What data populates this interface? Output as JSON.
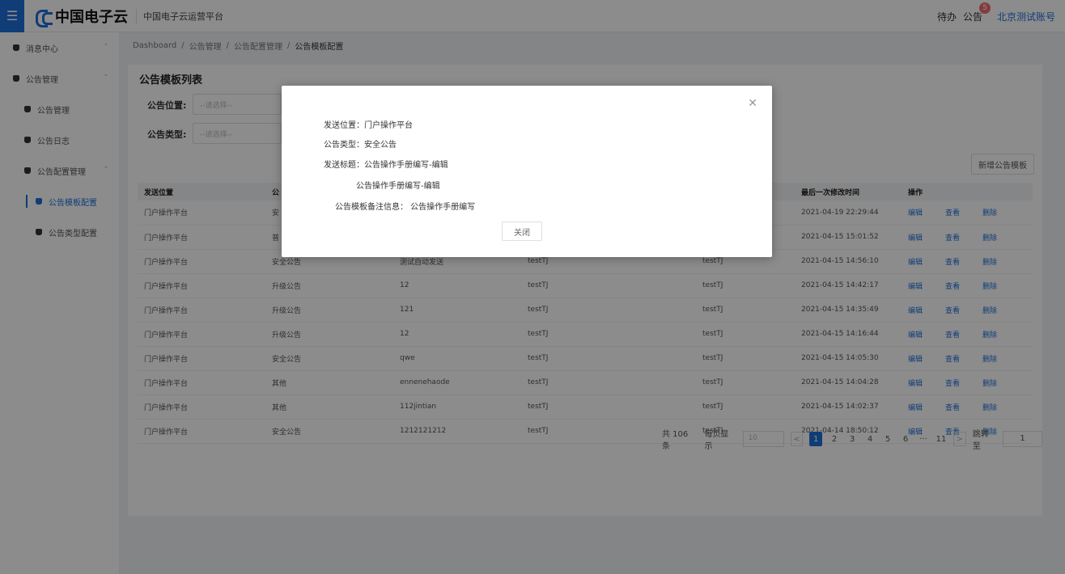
{
  "header": {
    "menu_icon": "hamburger-icon",
    "logo_text": "中国电子云",
    "platform": "中国电子云运营平台",
    "todo": "待办",
    "notice": "公告",
    "notice_badge": "5",
    "account": "北京测试账号"
  },
  "sidebar": {
    "items": [
      {
        "label": "消息中心",
        "expand": "˅"
      },
      {
        "label": "公告管理",
        "expand": "˄"
      },
      {
        "label": "公告管理"
      },
      {
        "label": "公告日志"
      },
      {
        "label": "公告配置管理",
        "expand": "˄"
      },
      {
        "label": "公告模板配置"
      },
      {
        "label": "公告类型配置"
      }
    ]
  },
  "breadcrumb": [
    "Dashboard",
    "/",
    "公告管理",
    "/",
    "公告配置管理",
    "/",
    "公告模板配置"
  ],
  "card": {
    "title": "公告模板列表",
    "filter_position_label": "公告位置:",
    "filter_position_placeholder": "--请选择--",
    "filter_type_label": "公告类型:",
    "filter_type_placeholder": "--请选择--",
    "add_button": "新增公告模板"
  },
  "table": {
    "headers": [
      "发送位置",
      "公",
      "",
      "",
      "",
      "最后一次修改时间",
      "操作",
      "",
      ""
    ],
    "rows": [
      [
        "门户操作平台",
        "安",
        "",
        "",
        "",
        "2021-04-19 22:29:44",
        "编辑",
        "查看",
        "删除"
      ],
      [
        "门户操作平台",
        "普",
        "",
        "",
        "",
        "2021-04-15 15:01:52",
        "编辑",
        "查看",
        "删除"
      ],
      [
        "门户操作平台",
        "安全公告",
        "测试自动发送",
        "testTJ",
        "testTJ",
        "2021-04-15 14:56:10",
        "编辑",
        "查看",
        "删除"
      ],
      [
        "门户操作平台",
        "升级公告",
        "12",
        "testTJ",
        "testTJ",
        "2021-04-15 14:42:17",
        "编辑",
        "查看",
        "删除"
      ],
      [
        "门户操作平台",
        "升级公告",
        "121",
        "testTJ",
        "testTJ",
        "2021-04-15 14:35:49",
        "编辑",
        "查看",
        "删除"
      ],
      [
        "门户操作平台",
        "升级公告",
        "12",
        "testTJ",
        "testTJ",
        "2021-04-15 14:16:44",
        "编辑",
        "查看",
        "删除"
      ],
      [
        "门户操作平台",
        "安全公告",
        "qwe",
        "testTJ",
        "testTJ",
        "2021-04-15 14:05:30",
        "编辑",
        "查看",
        "删除"
      ],
      [
        "门户操作平台",
        "其他",
        "ennenehaode",
        "testTJ",
        "testTJ",
        "2021-04-15 14:04:28",
        "编辑",
        "查看",
        "删除"
      ],
      [
        "门户操作平台",
        "其他",
        "112jintian",
        "testTJ",
        "testTJ",
        "2021-04-15 14:02:37",
        "编辑",
        "查看",
        "删除"
      ],
      [
        "门户操作平台",
        "安全公告",
        "1212121212",
        "testTJ",
        "testTJ",
        "2021-04-14 18:50:12",
        "编辑",
        "查看",
        "删除"
      ]
    ]
  },
  "pagination": {
    "total": "共 106 条",
    "per_page_label": "每页显示",
    "per_page_value": "10",
    "prev": "<",
    "pages": [
      "1",
      "2",
      "3",
      "4",
      "5",
      "6",
      "···",
      "11"
    ],
    "current": "1",
    "next": ">",
    "jump_label": "跳转至",
    "jump_value": "1"
  },
  "modal": {
    "close_icon": "close-icon",
    "line1": "发送位置：门户操作平台",
    "line2": "公告类型：安全公告",
    "line3": "发送标题：公告操作手册编写-编辑",
    "line4": "公告操作手册编写-编辑",
    "line5": "公告模板备注信息：  公告操作手册编写",
    "close_button": "关闭"
  }
}
